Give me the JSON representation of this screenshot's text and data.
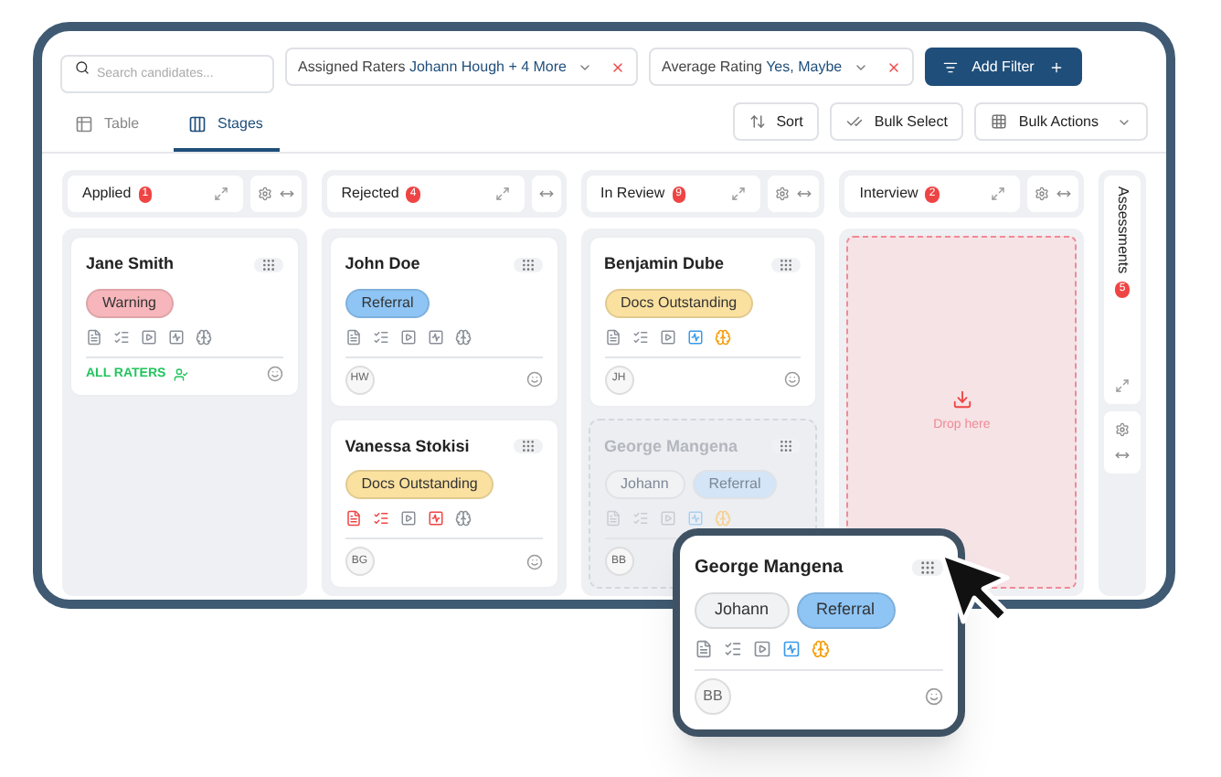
{
  "filters": {
    "search": {
      "placeholder": "Search candidates..."
    },
    "chips": [
      {
        "label": "Assigned Raters",
        "value": "Johann Hough + 4 More"
      },
      {
        "label": "Average Rating",
        "value": "Yes, Maybe"
      }
    ],
    "add_button": "Add Filter"
  },
  "views": [
    {
      "label": "Table",
      "kind": "table",
      "selected": false
    },
    {
      "label": "Stages",
      "kind": "stages",
      "selected": true
    }
  ],
  "actions": [
    {
      "label": "Sort",
      "kind": "sort"
    },
    {
      "label": "Bulk Select",
      "kind": "select"
    },
    {
      "label": "Bulk Actions",
      "kind": "grid"
    }
  ],
  "columns": [
    {
      "title": "Applied",
      "count": "1",
      "kind": "cards",
      "cards": [
        {
          "name": "Jane Smith",
          "ghost": false,
          "tags": [
            {
              "label": "Warning",
              "color": "#f7b6bb"
            }
          ],
          "icons": [
            {
              "color": "#8a8f98"
            },
            {
              "color": "#8a8f98"
            },
            {
              "color": "#8a8f98"
            },
            {
              "color": "#8a8f98"
            },
            {
              "color": "#8a8f98"
            }
          ],
          "footer": {
            "kind": "raters",
            "text": "ALL RATERS"
          }
        }
      ]
    },
    {
      "title": "Rejected",
      "count": "4",
      "kind": "cards",
      "cards": [
        {
          "name": "John Doe",
          "ghost": false,
          "tags": [
            {
              "label": "Referral",
              "color": "#8ec5f5"
            }
          ],
          "icons": [
            {
              "color": "#8a8f98"
            },
            {
              "color": "#8a8f98"
            },
            {
              "color": "#8a8f98"
            },
            {
              "color": "#8a8f98"
            },
            {
              "color": "#8a8f98"
            }
          ],
          "footer": {
            "kind": "avatar",
            "text": "HW"
          }
        },
        {
          "name": "Vanessa Stokisi",
          "ghost": false,
          "tags": [
            {
              "label": "Docs Outstanding",
              "color": "#fbe1a0"
            }
          ],
          "icons": [
            {
              "color": "#ef4444"
            },
            {
              "color": "#ef4444"
            },
            {
              "color": "#8a8f98"
            },
            {
              "color": "#ef4444"
            },
            {
              "color": "#8a8f98"
            }
          ],
          "footer": {
            "kind": "avatar",
            "text": "BG"
          }
        }
      ]
    },
    {
      "title": "In Review",
      "count": "9",
      "kind": "cards",
      "cards": [
        {
          "name": "Benjamin Dube",
          "ghost": false,
          "tags": [
            {
              "label": "Docs Outstanding",
              "color": "#fbe1a0"
            }
          ],
          "icons": [
            {
              "color": "#8a8f98"
            },
            {
              "color": "#8a8f98"
            },
            {
              "color": "#8a8f98"
            },
            {
              "color": "#3b9ae8"
            },
            {
              "color": "#f59e0b"
            }
          ],
          "footer": {
            "kind": "avatar",
            "text": "JH"
          }
        },
        {
          "name": "George Mangena",
          "ghost": true,
          "tags": [
            {
              "label": "Johann",
              "color": "#f1f2f4"
            },
            {
              "label": "Referral",
              "color": "#d3e5f6"
            }
          ],
          "icons": [
            {
              "color": "#c8ccd2"
            },
            {
              "color": "#c8ccd2"
            },
            {
              "color": "#c8ccd2"
            },
            {
              "color": "#a9d0f3"
            },
            {
              "color": "#f8cf8c"
            }
          ],
          "footer": {
            "kind": "avatar",
            "text": "BB"
          }
        }
      ]
    },
    {
      "title": "Interview",
      "count": "2",
      "kind": "drop",
      "drop_text": "Drop here"
    }
  ],
  "collapsed_column": {
    "title": "Assessments",
    "count": "5"
  },
  "dragged_card": {
    "name": "George Mangena",
    "tags": [
      {
        "label": "Johann",
        "color": "#f1f2f4"
      },
      {
        "label": "Referral",
        "color": "#8ec5f5"
      }
    ],
    "icons": [
      {
        "color": "#8a8f98"
      },
      {
        "color": "#8a8f98"
      },
      {
        "color": "#8a8f98"
      },
      {
        "color": "#3b9ae8"
      },
      {
        "color": "#f59e0b"
      }
    ],
    "footer": {
      "kind": "avatar",
      "text": "BB"
    }
  }
}
